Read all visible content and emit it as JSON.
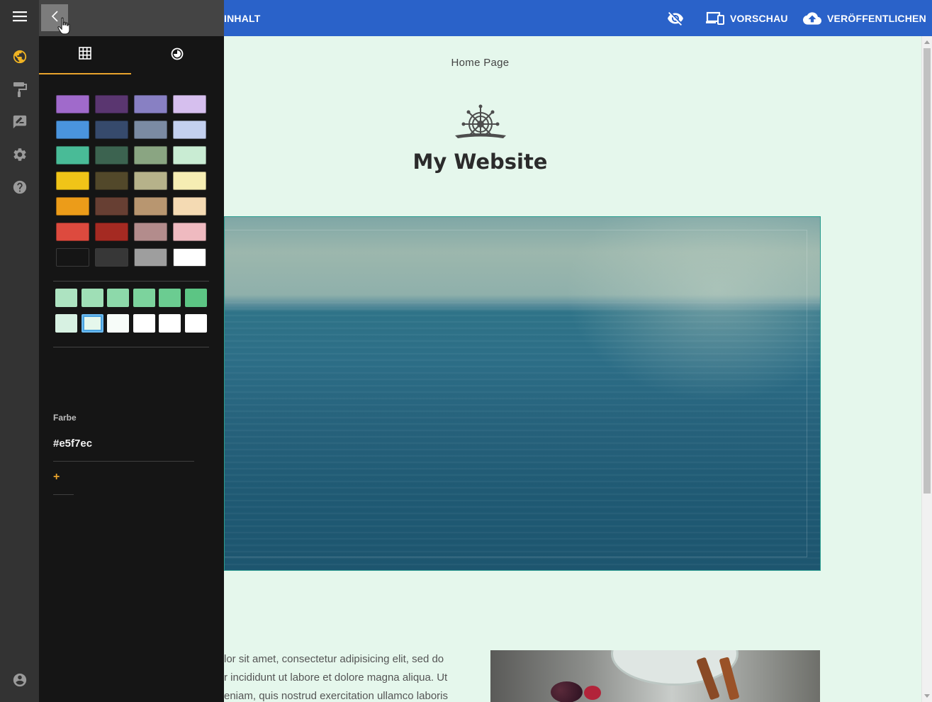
{
  "topbar": {
    "content_label": "INHALT",
    "preview_label": "VORSCHAU",
    "publish_label": "VERÖFFENTLICHEN",
    "color": "#2a62c9"
  },
  "canvas": {
    "page_label": "Home Page",
    "site_title": "My Website",
    "body_lines": [
      "lor sit amet, consectetur adipisicing elit, sed do",
      "r incididunt ut labore et dolore magna aliqua. Ut",
      "eniam, quis nostrud exercitation ullamco laboris"
    ],
    "background": "#e5f7ec"
  },
  "rail": {
    "items": [
      {
        "name": "globe-icon",
        "active": true
      },
      {
        "name": "paint-roller-icon",
        "active": false
      },
      {
        "name": "edit-note-icon",
        "active": false
      },
      {
        "name": "gear-icon",
        "active": false
      },
      {
        "name": "help-icon",
        "active": false
      }
    ],
    "bottom": "account-icon",
    "accent": "#f0b323"
  },
  "panel": {
    "tabs": [
      {
        "name": "grid-icon",
        "active": true
      },
      {
        "name": "theme-icon",
        "active": false
      }
    ],
    "palette": [
      [
        "#a06acb",
        "#5a3670",
        "#8880c3",
        "#d6bfee"
      ],
      [
        "#4a94dd",
        "#364a6c",
        "#7b8ba3",
        "#c3d0ef"
      ],
      [
        "#49bb97",
        "#3c6350",
        "#8aa582",
        "#c9ecd3"
      ],
      [
        "#f0c418",
        "#52482a",
        "#b6b28a",
        "#f6edb3"
      ],
      [
        "#ec9c19",
        "#673f33",
        "#b89670",
        "#f4dab3"
      ],
      [
        "#dd4a3e",
        "#a52a22",
        "#b38c8c",
        "#efbac0"
      ],
      [
        "#151515",
        "#373737",
        "#9e9e9e",
        "#ffffff"
      ]
    ],
    "shades": [
      [
        "#ade3c1",
        "#9fdfb6",
        "#8dd9aa",
        "#7cd39d",
        "#6bcc91",
        "#5cc584"
      ],
      [
        "#d7f1e2",
        "#e5f7ec",
        "#f7fcf9",
        "#ffffff",
        "#ffffff",
        "#ffffff"
      ]
    ],
    "selected_shade": 1,
    "color_label": "Farbe",
    "color_value": "#e5f7ec",
    "add_label": "+"
  }
}
